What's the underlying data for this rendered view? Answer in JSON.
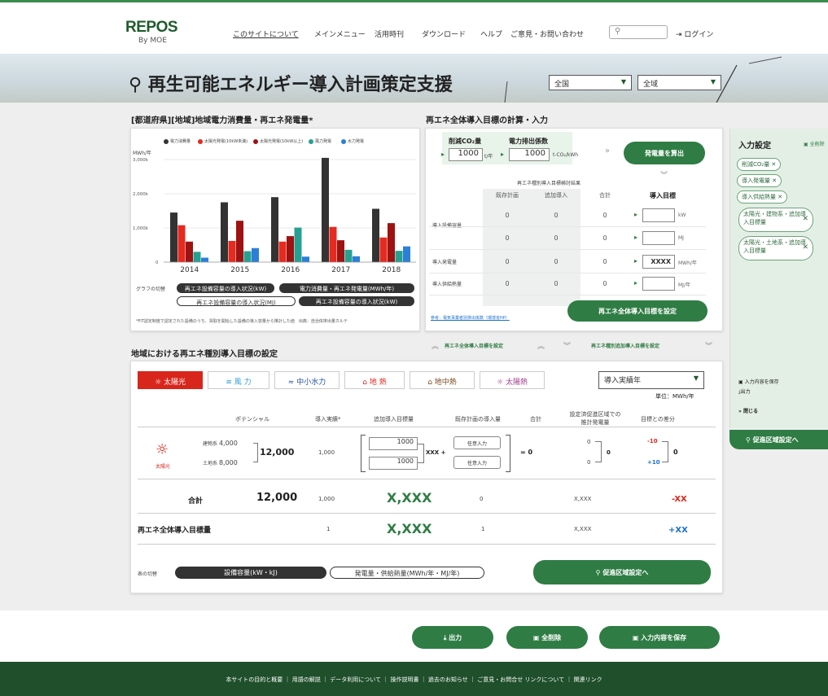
{
  "header": {
    "logo": "REPOS",
    "logo_sub": "By MOE",
    "nav": [
      "このサイトについて",
      "メインメニュー",
      "活用時刊",
      "ダウンロード",
      "ヘルプ",
      "ご意見・お問い合わせ"
    ],
    "login": "ログイン"
  },
  "hero": {
    "title": "再生可能エネルギー導入計画策定支援",
    "pref": "全国",
    "area": "全域"
  },
  "left": {
    "title": "[都道府県][地域]地域電力消費量・再エネ発電量*",
    "legend": [
      "電力消費量",
      "太陽光発電(10kW未満)",
      "太陽光発電(10kW以上)",
      "風力発電",
      "水力発電"
    ],
    "switch_label": "グラフの切替",
    "pills": [
      "再エネ設備容量の導入状況(kW)",
      "電力消費量・再エネ発電量(MWh/年)",
      "再エネ設備容量の導入状況(MJ)",
      "再エネ設備容量の導入状況(kW)"
    ],
    "note": "*FIT認定制度で認定された設備のうち、買取を開始した設備の導入容量から推計した値　出典：自治体排出量カルテ"
  },
  "chart_data": {
    "type": "bar",
    "ylabel": "MWh/年",
    "ylim": [
      0,
      3000
    ],
    "yticks": [
      "3,000k",
      "2,000k",
      "1,000k",
      "0"
    ],
    "categories": [
      "2014",
      "2015",
      "2016",
      "2017",
      "2018"
    ],
    "series": [
      {
        "name": "電力消費量",
        "values": [
          1450,
          1750,
          1900,
          3050,
          1560
        ]
      },
      {
        "name": "太陽光発電(10kW未満)",
        "values": [
          1080,
          620,
          600,
          1030,
          720
        ]
      },
      {
        "name": "太陽光発電(10kW以上)",
        "values": [
          600,
          1210,
          760,
          640,
          1140
        ]
      },
      {
        "name": "風力発電",
        "values": [
          300,
          320,
          1010,
          360,
          330
        ]
      },
      {
        "name": "水力発電",
        "values": [
          130,
          410,
          160,
          170,
          460
        ]
      }
    ],
    "colors": [
      "#333333",
      "#e52a20",
      "#9e1212",
      "#27a092",
      "#2c7fd6"
    ]
  },
  "calc": {
    "title": "再エネ全体導入目標の計算・入力",
    "co2_label": "削減CO₂量",
    "co2_val": "1000",
    "co2_unit": "t/年",
    "ef_label": "電力排出係数",
    "ef_val": "1000",
    "ef_unit": "t-CO₂/kWh",
    "calc_btn": "発電量を算出",
    "result_title": "再エネ種別導入目標検討結果",
    "cols": [
      "既存計画",
      "追加導入",
      "合計",
      "導入目標"
    ],
    "rows": [
      {
        "label": "導入設備容量",
        "vals": [
          "0",
          "0",
          "0"
        ],
        "unit": "kW",
        "input": ""
      },
      {
        "label": "",
        "vals": [
          "0",
          "0",
          "0"
        ],
        "unit": "MJ",
        "input": ""
      },
      {
        "label": "導入発電量",
        "vals": [
          "0",
          "0",
          "0"
        ],
        "unit": "MWh/年",
        "input": "XXXX"
      },
      {
        "label": "導入供給熱量",
        "vals": [
          "0",
          "0",
          "0"
        ],
        "unit": "MJ/年",
        "input": ""
      }
    ],
    "ref": "参考：電気事業者別排出係数（環境省HP）",
    "set_btn": "再エネ全体導入目標を設定"
  },
  "collapse": [
    "再エネ全体導入目標を設定",
    "再エネ種別追加導入目標を設定"
  ],
  "side": {
    "title": "入力設定",
    "clear_all": "全削除",
    "chips": [
      "削減CO₂量 ✕",
      "導入発電量 ✕",
      "導入供給熱量 ✕",
      "太陽光・建物系・追加導入目標量",
      "太陽光・土地系・追加導入目標量"
    ],
    "links": [
      "入力内容を保存",
      "出力",
      "閉じる"
    ],
    "promo": "促進区域設定へ"
  },
  "region": {
    "title": "地域における再エネ種別導入目標の設定",
    "tabs": [
      "太陽光",
      "風 力",
      "中小水力",
      "地 熱",
      "地中熱",
      "太陽熱"
    ],
    "perf": "導入実績年",
    "unit": "単位：MWh/年",
    "headers": [
      "ポテンシャル",
      "導入実績*",
      "追加導入目標量",
      "既存計画の導入量",
      "合計",
      "設定済促進区域での推計発電量",
      "目標との差分"
    ],
    "solar_label": "太陽光",
    "bld": "建物系",
    "bld_val": "4,000",
    "land": "土地系",
    "land_val": "8,000",
    "pot_total": "12,000",
    "perf_val": "1,000",
    "add1": "1000",
    "add2": "1000",
    "add_sum": "XXX",
    "any": "任意入力",
    "eq": "= 0",
    "est1": "0",
    "est2": "0",
    "est_sum": "0",
    "diff1": "-10",
    "diff2": "+10",
    "diff_sum": "0",
    "total_label": "合計",
    "total_pot": "12,000",
    "total_perf": "1,000",
    "total_add": "X,XXX",
    "total_exist": "0",
    "total_est": "X,XXX",
    "total_diff": "-XX",
    "all_label": "再エネ全体導入目標量",
    "all_perf": "1",
    "all_add": "X,XXX",
    "all_exist": "1",
    "all_est": "X,XXX",
    "all_diff": "+XX",
    "switch_label": "表の切替",
    "sw1": "設備容量(kW・kJ)",
    "sw2": "発電量・供給熱量(MWh/年・MJ/年)",
    "promo": "促進区域設定へ"
  },
  "bottom": {
    "out": "出力",
    "clear": "全削除",
    "save": "入力内容を保存"
  },
  "footer": "本サイトの目的と概要 ｜ 用語の解説 ｜ データ利用について ｜ 操作説明書 ｜ 過去のお知らせ ｜ ご意見・お問合せ リンクについて ｜ 関連リンク"
}
